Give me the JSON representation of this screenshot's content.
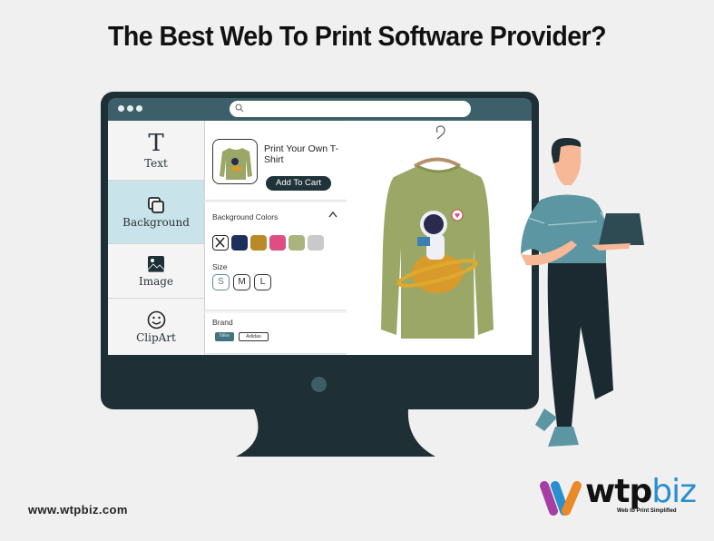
{
  "headline": "The Best Web To Print Software Provider?",
  "browser": {
    "search_placeholder": "",
    "search_icon": "search-icon"
  },
  "sidebar": {
    "items": [
      {
        "label": "Text",
        "icon": "text-t-icon",
        "active": false
      },
      {
        "label": "Background",
        "icon": "layers-icon",
        "active": true
      },
      {
        "label": "Image",
        "icon": "image-icon",
        "active": false
      },
      {
        "label": "ClipArt",
        "icon": "smiley-icon",
        "active": false
      }
    ]
  },
  "product": {
    "title": "Print Your Own T-Shirt",
    "add_to_cart_label": "Add To Cart"
  },
  "options": {
    "background_colors_label": "Background Colors",
    "colors": [
      "none",
      "#1e2f5e",
      "#b9892a",
      "#df4d85",
      "#aab57e",
      "#c9c9c9"
    ],
    "size_label": "Size",
    "sizes": [
      "S",
      "M",
      "L"
    ],
    "selected_size": "S",
    "brand_label": "Brand",
    "brands": [
      "Nike",
      "Adidas"
    ],
    "selected_brand": "Nike"
  },
  "footer": {
    "url": "www.wtpbiz.com",
    "logo_wordmark_a": "wtp",
    "logo_wordmark_b": "biz",
    "logo_tagline": "Web to Print Simplified"
  },
  "colors": {
    "monitor": "#1e2f36",
    "titlebar": "#3c5f69",
    "active_sidebar": "#c8e4ea",
    "shirt": "#9aa767",
    "brand_blue": "#2a8fcf"
  }
}
